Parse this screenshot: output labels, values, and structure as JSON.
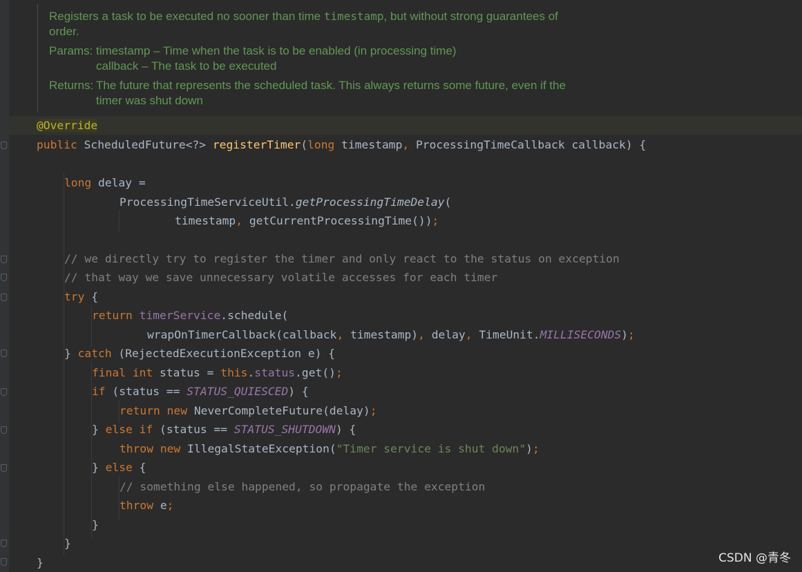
{
  "javadoc": {
    "desc_a": "Registers a task to be executed no sooner than time ",
    "desc_code": "timestamp",
    "desc_b": ", but without strong guarantees of",
    "desc_c": "order.",
    "params_label": "Params:",
    "param1": "timestamp – Time when the task is to be enabled (in processing time)",
    "param2": "callback – The task to be executed",
    "returns_label": "Returns:",
    "returns1": "The future that represents the scheduled task. This always returns some future, even if the",
    "returns2": "timer was shut down"
  },
  "code": {
    "annotation": "@Override",
    "kw_public": "public",
    "ret_type": " ScheduledFuture<?> ",
    "method": "registerTimer",
    "sig_open": "(",
    "kw_long": "long",
    "p_timestamp": " timestamp",
    "comma": ",",
    "p_callback": " ProcessingTimeCallback callback) {",
    "delay_decl": " delay =",
    "util_class": "ProcessingTimeServiceUtil.",
    "util_method": "getProcessingTimeDelay",
    "paren_open": "(",
    "arg_timestamp": "timestamp",
    "arg_current": " getCurrentProcessingTime())",
    "semi": ";",
    "comment1": "// we directly try to register the timer and only react to the status on exception",
    "comment2": "// that way we save unnecessary volatile accesses for each timer",
    "kw_try": "try",
    "brace_open": " {",
    "kw_return": "return",
    "timer_service": "timerService",
    "schedule_call": ".schedule(",
    "wrap_call": "wrapOnTimerCallback(callback",
    "wrap_ts": " timestamp)",
    "delay_arg": " delay",
    "timeunit": " TimeUnit.",
    "milliseconds": "MILLISECONDS",
    "close_paren": ")",
    "close_catch": "} ",
    "kw_catch": "catch",
    "catch_sig": " (RejectedExecutionException e) {",
    "kw_final": "final",
    "kw_int": " int",
    "status_decl": " status = ",
    "kw_this": "this",
    "dot": ".",
    "status_field": "status",
    "get_call": ".get()",
    "kw_if": "if",
    "if_cond_open": " (status == ",
    "status_quiesced": "STATUS_QUIESCED",
    "if_cond_close": ") {",
    "kw_new": " new",
    "never_future": " NeverCompleteFuture(delay)",
    "close_brace_sp": "} ",
    "kw_else": "else",
    "kw_if_sp": " if",
    "status_shutdown": "STATUS_SHUTDOWN",
    "kw_throw": "throw",
    "illegal_state": " IllegalStateException(",
    "msg": "\"Timer service is shut down\"",
    "comment3": "// something else happened, so propagate the exception",
    "throw_e": " e",
    "close_brace": "}"
  },
  "watermark": "CSDN @青冬"
}
